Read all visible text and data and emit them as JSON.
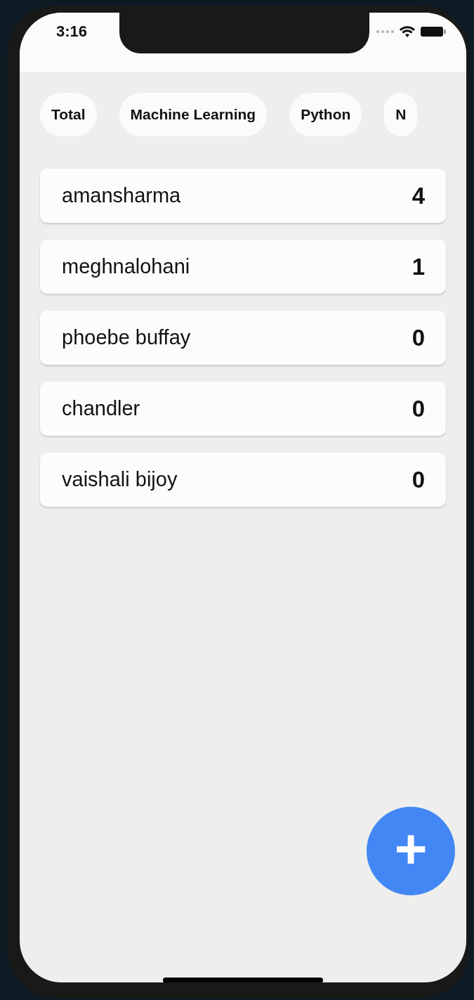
{
  "status_bar": {
    "time": "3:16"
  },
  "categories": [
    {
      "label": "Total"
    },
    {
      "label": "Machine Learning"
    },
    {
      "label": "Python"
    },
    {
      "label": "N"
    }
  ],
  "users": [
    {
      "name": "amansharma",
      "count": "4"
    },
    {
      "name": "meghnalohani",
      "count": "1"
    },
    {
      "name": "phoebe buffay",
      "count": "0"
    },
    {
      "name": "chandler",
      "count": "0"
    },
    {
      "name": "vaishali bijoy",
      "count": "0"
    }
  ],
  "fab": {
    "label": "+"
  }
}
